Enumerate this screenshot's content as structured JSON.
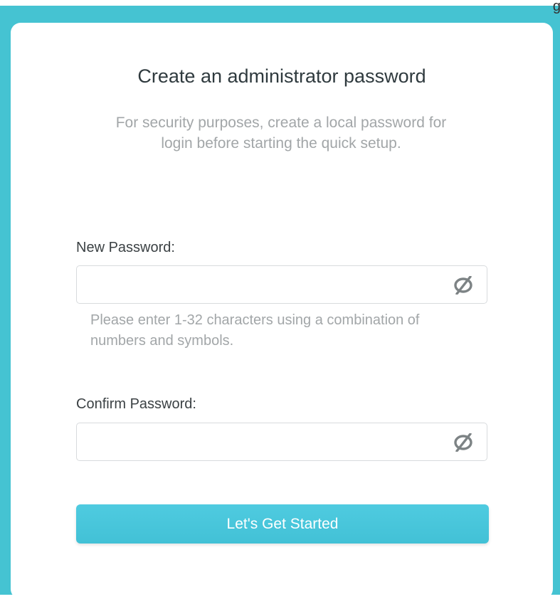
{
  "corner_text": "g",
  "form": {
    "title": "Create an administrator password",
    "subtitle": "For security purposes, create a local password for login before starting the quick setup.",
    "new_password_label": "New Password:",
    "new_password_value": "",
    "new_password_hint": "Please enter 1-32 characters using a combination of numbers and symbols.",
    "confirm_password_label": "Confirm Password:",
    "confirm_password_value": "",
    "submit_label": "Let's Get Started"
  },
  "icons": {
    "visibility_toggle": "eye-hidden-icon"
  },
  "colors": {
    "frame": "#45c3d2",
    "button": "#45c3d6",
    "title": "#2f3a3e",
    "muted_text": "#a2a6a8"
  }
}
